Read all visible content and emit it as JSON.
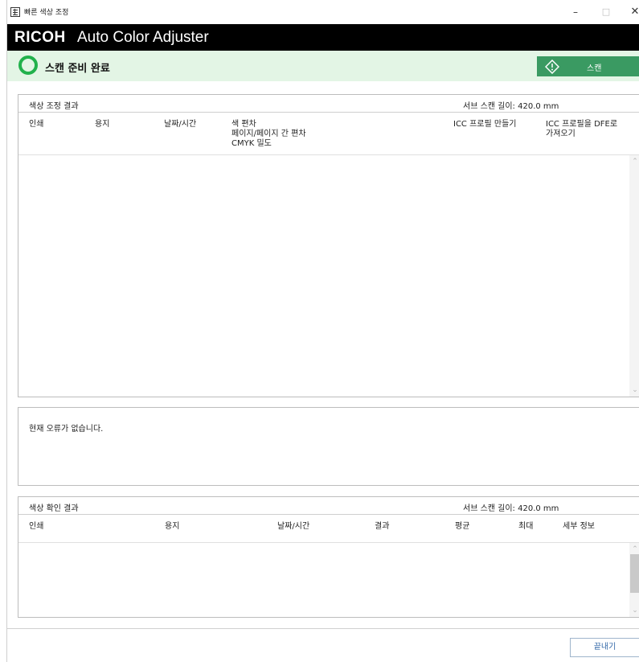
{
  "window": {
    "title": "빠른 색상 조정",
    "minimize": "–",
    "maximize": "□",
    "close": "✕"
  },
  "brand": {
    "logo": "RICOH",
    "product": "Auto Color Adjuster"
  },
  "status": {
    "text": "스캔 준비 완료",
    "scan_label": "스캔",
    "icon": "status-ring-icon"
  },
  "adjust_panel": {
    "title": "색상 조정 결과",
    "sub_scan_length": "서브 스캔 길이: 420.0 mm",
    "columns": {
      "print": "인쇄",
      "paper": "용지",
      "datetime": "날짜/시간",
      "color_dev_1": "색 편차",
      "color_dev_2": "페이지/페이지 간 편차",
      "color_dev_3": "CMYK 밀도",
      "icc_make": "ICC 프로필 만들기",
      "icc_import_1": "ICC 프로필을 DFE로",
      "icc_import_2": "가져오기"
    }
  },
  "error_panel": {
    "message": "현재 오류가 없습니다."
  },
  "check_panel": {
    "title": "색상 확인 결과",
    "sub_scan_length": "서브 스캔 길이: 420.0 mm",
    "columns": {
      "print": "인쇄",
      "paper": "용지",
      "datetime": "날짜/시간",
      "result": "결과",
      "average": "평균",
      "max": "최대",
      "details": "세부 정보"
    }
  },
  "footer": {
    "close_label": "끝내기"
  },
  "colors": {
    "brand_bg": "#000000",
    "status_bg": "#e3f5e5",
    "status_ring": "#22b14c",
    "scan_button": "#3a9a62",
    "close_text": "#3469a8"
  }
}
